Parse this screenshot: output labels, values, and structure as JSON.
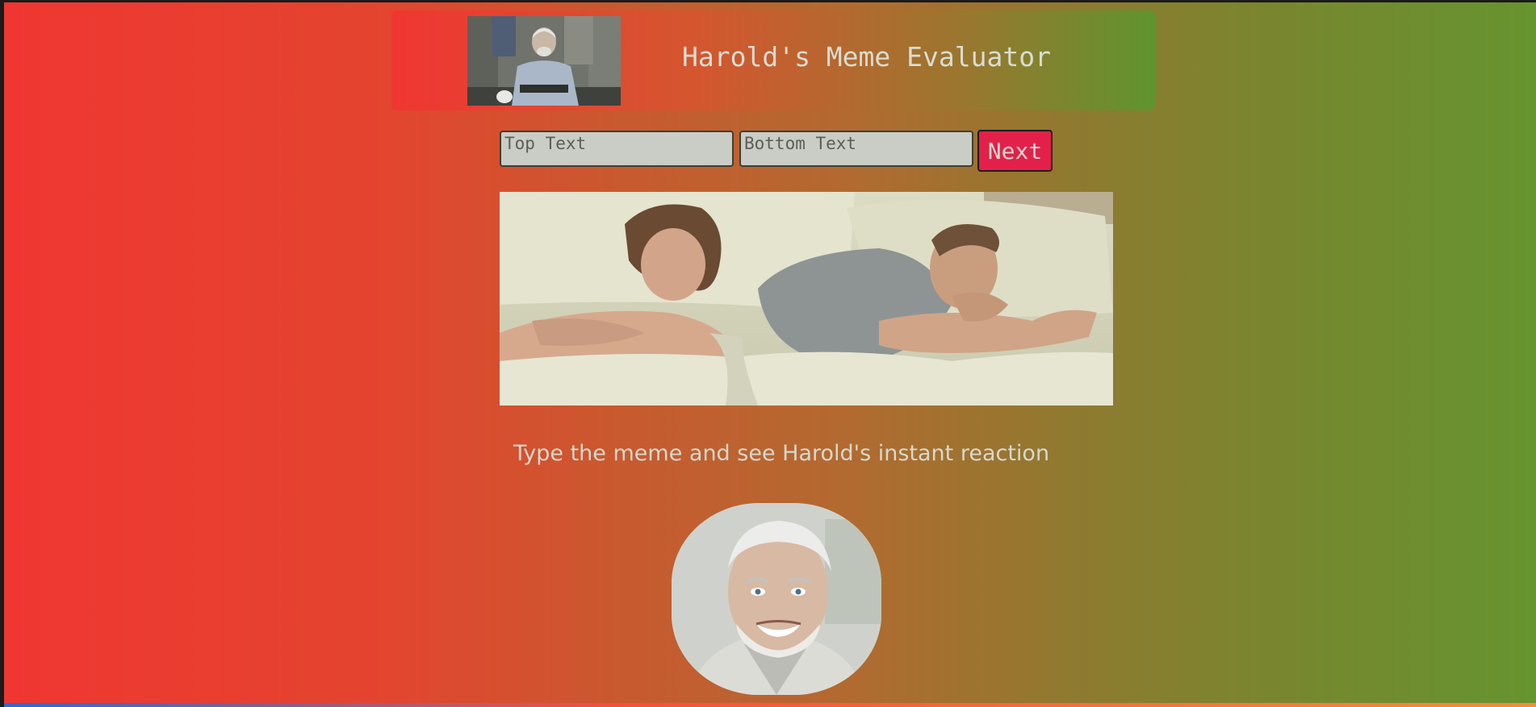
{
  "header": {
    "title": "Harold's Meme Evaluator",
    "photo_icon": "harold-group-photo"
  },
  "form": {
    "top_placeholder": "Top Text",
    "bottom_placeholder": "Bottom Text",
    "top_value": "",
    "bottom_value": "",
    "next_label": "Next"
  },
  "meme": {
    "image_icon": "couple-in-bed-photo"
  },
  "instruction": "Type the meme and see Harold's instant reaction",
  "reaction": {
    "image_icon": "harold-smiling-face"
  },
  "colors": {
    "gradient_left": "#f03632",
    "gradient_right": "#66942f",
    "next_button": "#e3204a",
    "input_background": "#c9cdc5",
    "title_text": "#d9ddd3"
  }
}
